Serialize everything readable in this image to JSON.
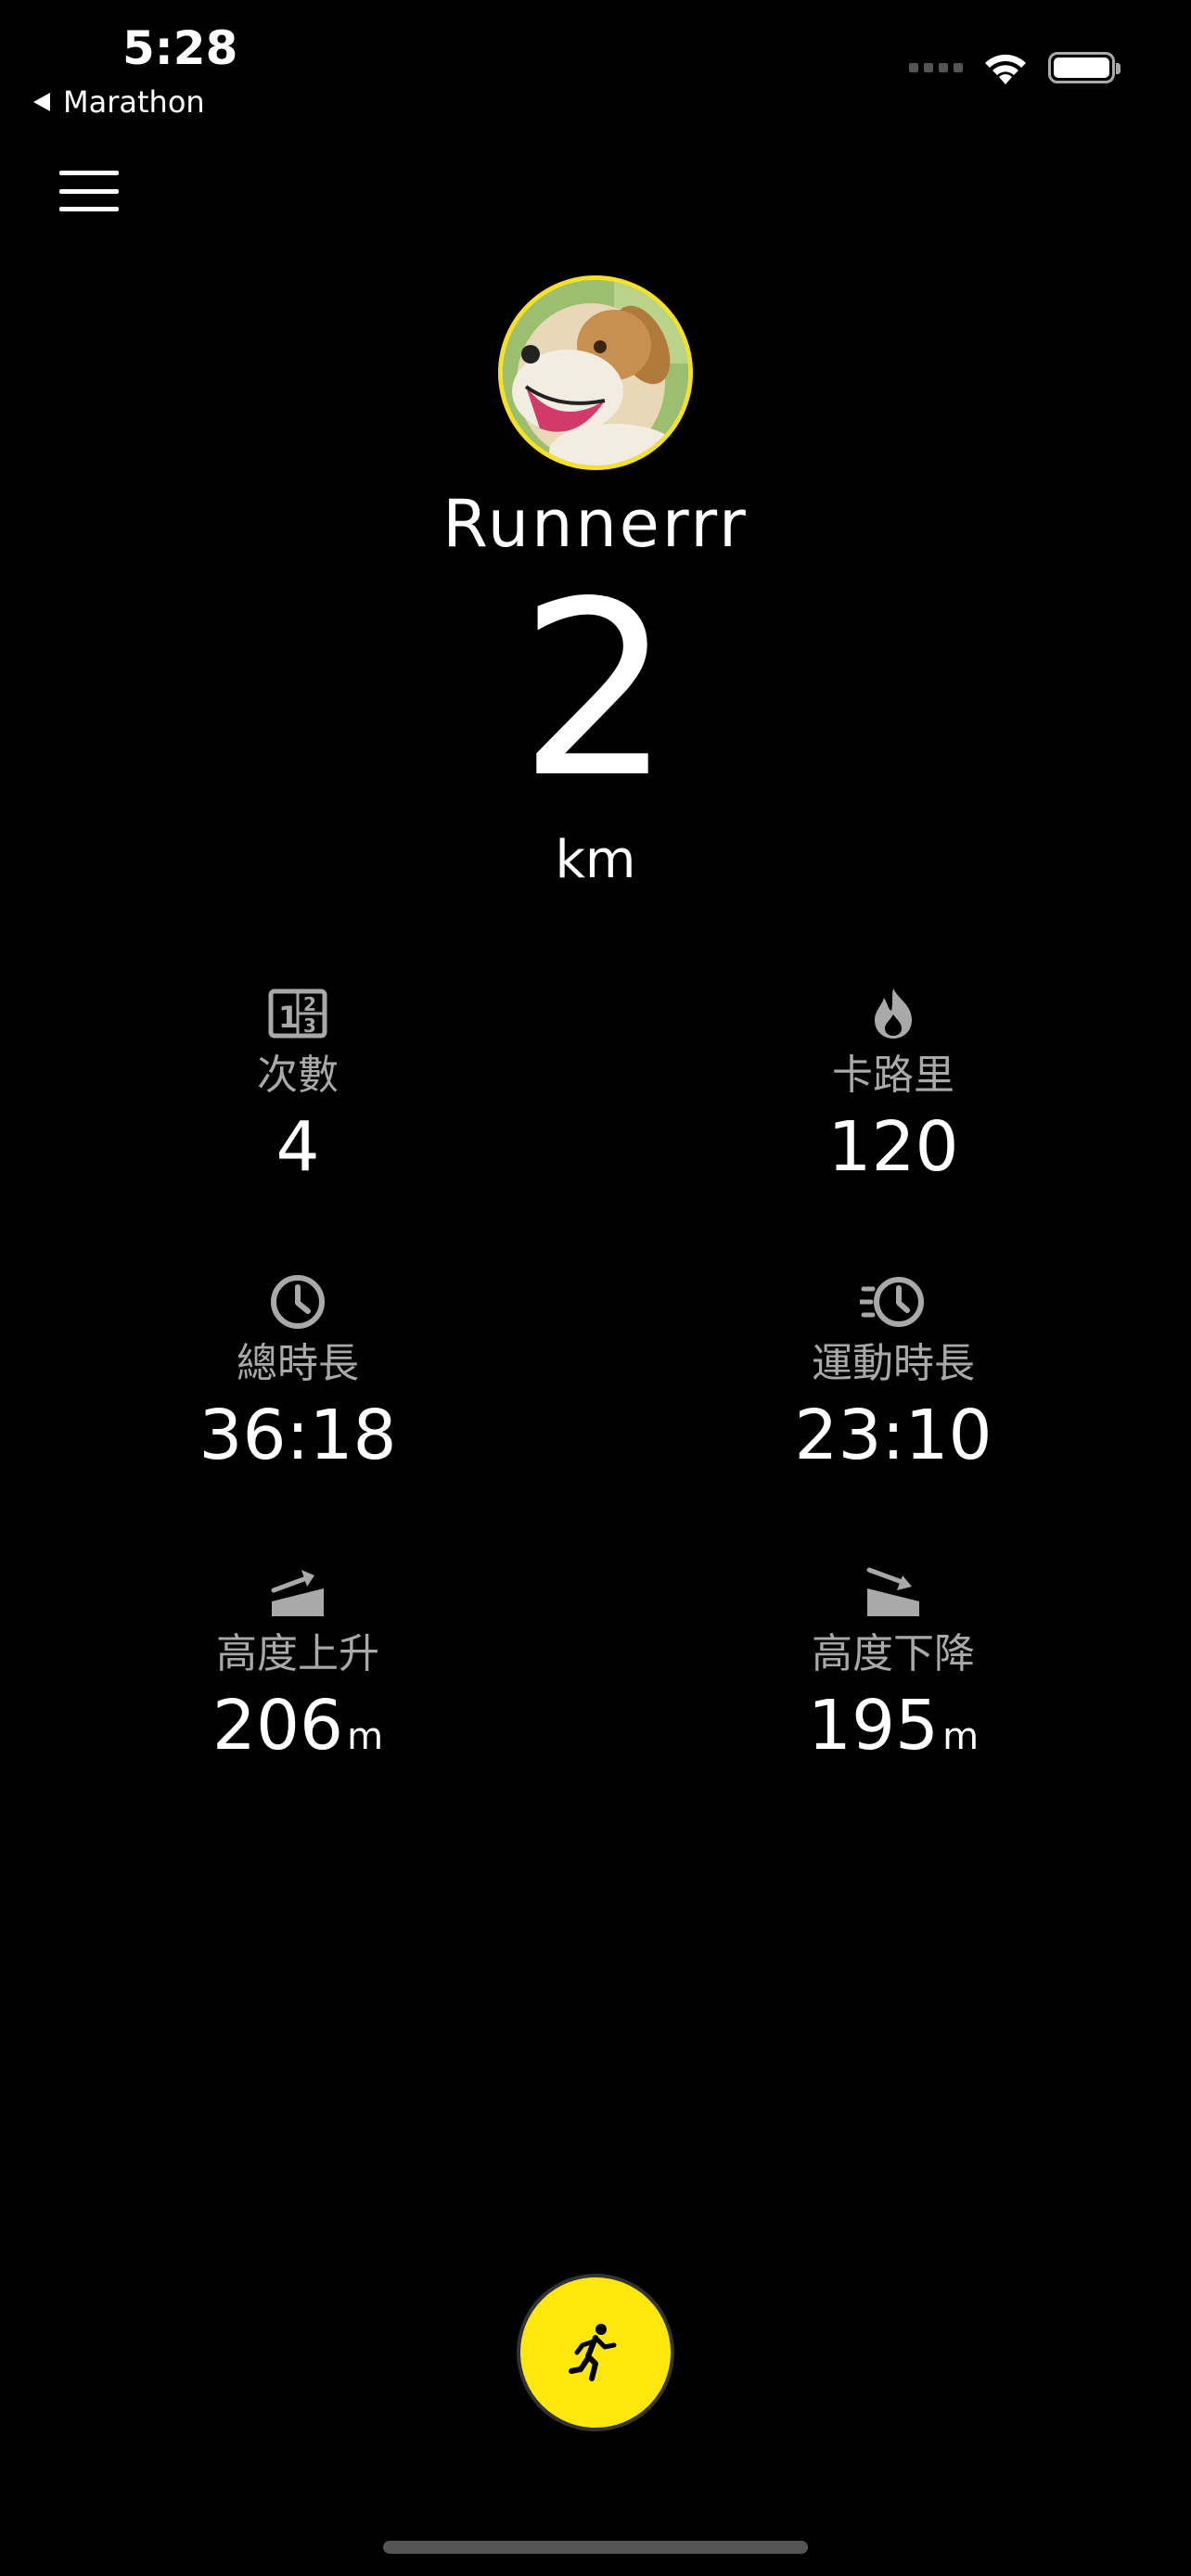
{
  "status_bar": {
    "time": "5:28",
    "back_app": "Marathon"
  },
  "profile": {
    "username": "Runnerrr",
    "distance": "2",
    "distance_unit": "km"
  },
  "stats": {
    "count": {
      "label": "次數",
      "value": "4",
      "icon": "counter-icon"
    },
    "calories": {
      "label": "卡路里",
      "value": "120",
      "icon": "flame-icon"
    },
    "total_time": {
      "label": "總時長",
      "value": "36:18",
      "icon": "clock-icon"
    },
    "active_time": {
      "label": "運動時長",
      "value": "23:10",
      "icon": "fast-clock-icon"
    },
    "elevation_gain": {
      "label": "高度上升",
      "value": "206",
      "unit": "m",
      "icon": "incline-up-icon"
    },
    "elevation_loss": {
      "label": "高度下降",
      "value": "195",
      "unit": "m",
      "icon": "incline-down-icon"
    }
  },
  "colors": {
    "accent": "#fde70c",
    "background": "#000000",
    "label_gray": "#a9a9a9"
  },
  "actions": {
    "start_icon": "running-icon"
  }
}
